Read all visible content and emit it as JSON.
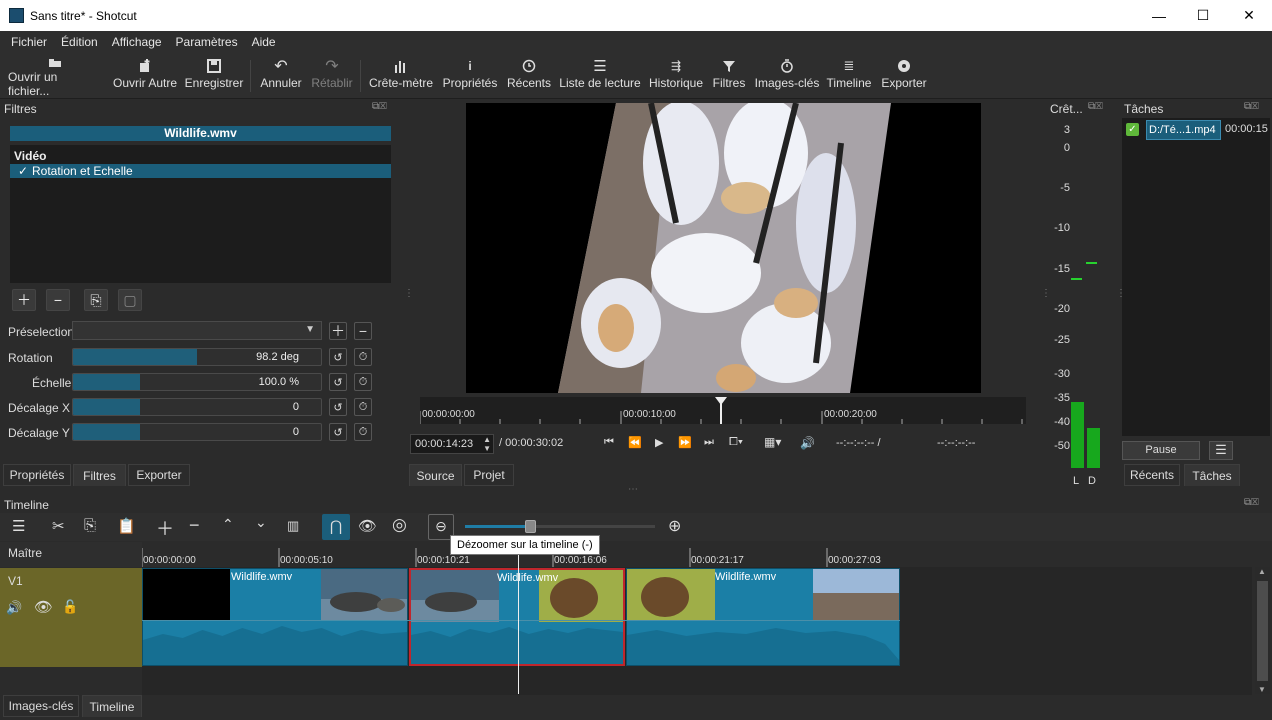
{
  "window": {
    "title": "Sans titre* - Shotcut",
    "minimize": "—",
    "maximize": "☐",
    "close": "✕"
  },
  "menu": [
    {
      "label": "Fichier"
    },
    {
      "label": "Édition"
    },
    {
      "label": "Affichage"
    },
    {
      "label": "Paramètres"
    },
    {
      "label": "Aide"
    }
  ],
  "toolbar": {
    "open_file": "Ouvrir un fichier...",
    "open_other": "Ouvrir Autre",
    "save": "Enregistrer",
    "undo": "Annuler",
    "redo": "Rétablir",
    "peak_meter": "Crête-mètre",
    "properties": "Propriétés",
    "recent": "Récents",
    "playlist": "Liste de lecture",
    "history": "Historique",
    "filters": "Filtres",
    "keyframes": "Images-clés",
    "timeline": "Timeline",
    "export": "Exporter"
  },
  "filters_panel": {
    "title": "Filtres",
    "clip_name": "Wildlife.wmv",
    "category": "Vidéo",
    "filter_item": "Rotation et Echelle",
    "check": "✓",
    "preset_label": "Préselection",
    "params": [
      {
        "label": "Rotation",
        "value": "98.2 deg",
        "fraction": 0.5
      },
      {
        "label": "Échelle",
        "value": "100.0 %",
        "fraction": 0.27
      },
      {
        "label": "Décalage X",
        "value": "0",
        "fraction": 0.27
      },
      {
        "label": "Décalage Y",
        "value": "0",
        "fraction": 0.27
      }
    ],
    "tabs": [
      "Propriétés",
      "Filtres",
      "Exporter"
    ]
  },
  "player": {
    "ruler": [
      "00:00:00:00",
      "00:00:10:00",
      "00:00:20:00"
    ],
    "position": "00:00:14:23",
    "duration": "/ 00:00:30:02",
    "in_point": "--:--:--:-- /",
    "out_point": "--:--:--:--",
    "tabs": [
      "Source",
      "Projet"
    ]
  },
  "meter": {
    "title": "Crêt...",
    "scale": [
      "3",
      "0",
      "-5",
      "-10",
      "-15",
      "-20",
      "-25",
      "-30",
      "-35",
      "-40",
      "-50"
    ],
    "left": "L",
    "right": "D"
  },
  "tasks": {
    "title": "Tâches",
    "job_name": "D:/Té...1.mp4",
    "job_time": "00:00:15",
    "pause_label": "Pause",
    "tabs": [
      "Récents",
      "Tâches"
    ]
  },
  "timeline": {
    "title": "Timeline",
    "tooltip": "Dézoomer sur la timeline (-)",
    "master": "Maître",
    "track": "V1",
    "ruler": [
      "00:00:00:00",
      "00:00:05:10",
      "00:00:10:21",
      "00:00:16:06",
      "00:00:21:17",
      "00:00:27:03"
    ],
    "clips": [
      {
        "label": "Wildlife.wmv"
      },
      {
        "label": "Wildlife.wmv"
      },
      {
        "label": "Wildlife.wmv"
      }
    ],
    "zoom_fraction": 0.34
  },
  "bottom_tabs": [
    "Images-clés",
    "Timeline"
  ]
}
